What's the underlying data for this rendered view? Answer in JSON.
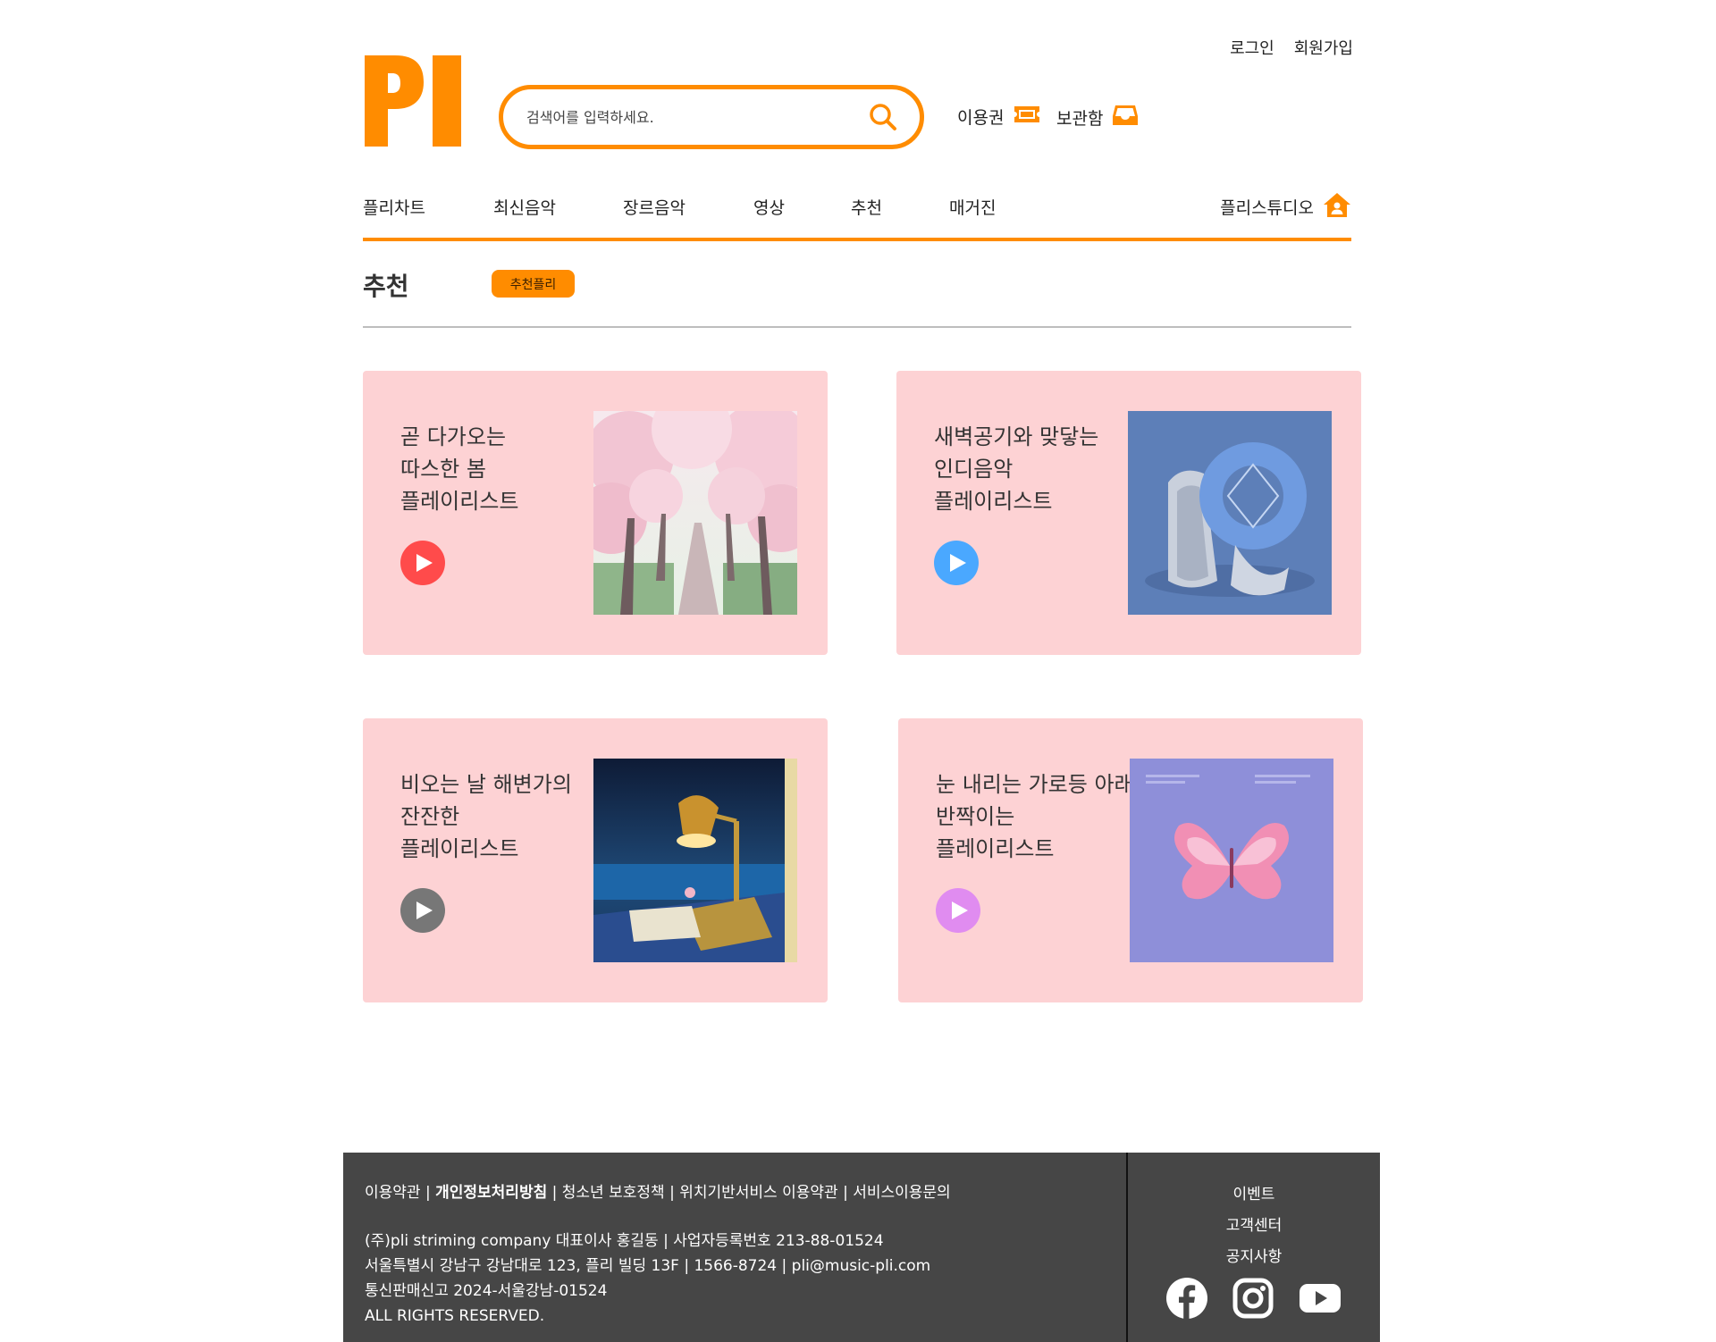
{
  "header": {
    "login": "로그인",
    "signup": "회원가입",
    "search_placeholder": "검색어를 입력하세요.",
    "pass_label": "이용권",
    "storage_label": "보관함"
  },
  "nav": {
    "items": [
      "플리차트",
      "최신음악",
      "장르음악",
      "영상",
      "추천",
      "매거진"
    ],
    "studio": "플리스튜디오"
  },
  "section": {
    "title": "추천",
    "badge": "추천플리"
  },
  "cards": [
    {
      "line1": "곧 다가오는",
      "line2": "따스한 봄",
      "line3": "플레이리스트",
      "play_color": "#ff4b4b"
    },
    {
      "line1": "새벽공기와 맞닿는",
      "line2": "인디음악",
      "line3": "플레이리스트",
      "play_color": "#4aa8ff"
    },
    {
      "line1": "비오는 날 해변가의",
      "line2": "잔잔한",
      "line3": "플레이리스트",
      "play_color": "#777777"
    },
    {
      "line1": "눈 내리는 가로등 아래",
      "line2": "반짝이는",
      "line3": "플레이리스트",
      "play_color": "#e08cf0"
    }
  ],
  "footer": {
    "links": [
      "이용약관",
      "개인정보처리방침",
      "청소년 보호정책",
      "위치기반서비스 이용약관",
      "서비스이용문의"
    ],
    "separator": " | ",
    "info": [
      "(주)pli striming company 대표이사 홍길동 | 사업자등록번호 213-88-01524",
      "서울특별시 강남구 강남대로 123, 플리 빌딩 13F | 1566-8724 | pli@music-pli.com",
      "통신판매신고 2024-서울강남-01524",
      "ALL RIGHTS RESERVED."
    ],
    "right_links": [
      "이벤트",
      "고객센터",
      "공지사항"
    ]
  },
  "colors": {
    "accent": "#ff8c00",
    "card_bg": "#fdd2d4",
    "footer_bg": "#464646"
  },
  "icons": {
    "logo": "pi-logo",
    "search": "search-icon",
    "pass": "ticket-icon",
    "storage": "inbox-icon",
    "studio": "home-user-icon",
    "socials": [
      "facebook-icon",
      "instagram-icon",
      "youtube-icon"
    ]
  }
}
